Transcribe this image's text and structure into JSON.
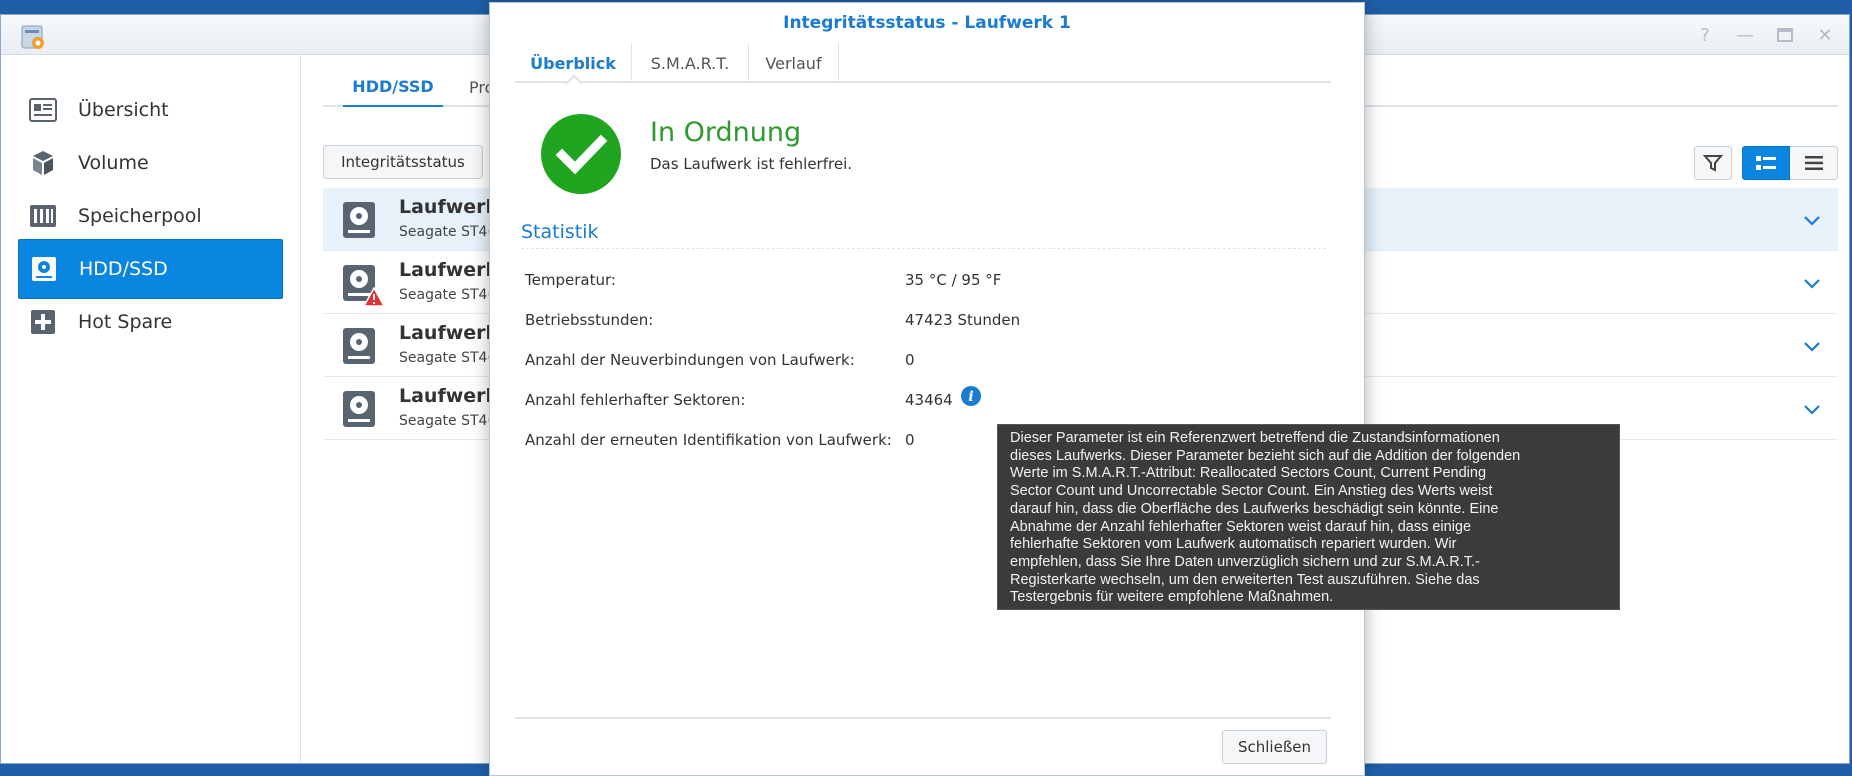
{
  "sidebar": {
    "items": [
      {
        "label": "Übersicht",
        "icon": "overview-icon"
      },
      {
        "label": "Volume",
        "icon": "volume-icon"
      },
      {
        "label": "Speicherpool",
        "icon": "storage-pool-icon"
      },
      {
        "label": "HDD/SSD",
        "icon": "hdd-icon",
        "active": true
      },
      {
        "label": "Hot Spare",
        "icon": "hot-spare-icon"
      }
    ]
  },
  "main": {
    "tabs": [
      {
        "label": "HDD/SSD",
        "active": true
      },
      {
        "label": "Pro"
      }
    ],
    "integrity_button": "Integritätsstatus",
    "drives": [
      {
        "name": "Laufwerk",
        "model": "Seagate ST4(",
        "warning": false,
        "selected": true
      },
      {
        "name": "Laufwerk",
        "model": "Seagate ST4(",
        "warning": true
      },
      {
        "name": "Laufwerk",
        "model": "Seagate ST4(",
        "warning": false
      },
      {
        "name": "Laufwerk",
        "model": "Seagate ST4(",
        "warning": false
      }
    ]
  },
  "dialog": {
    "title": "Integritätsstatus - Laufwerk 1",
    "tabs": [
      "Überblick",
      "S.M.A.R.T.",
      "Verlauf"
    ],
    "status_title": "In Ordnung",
    "status_subtitle": "Das Laufwerk ist fehlerfrei.",
    "section_title": "Statistik",
    "stats": [
      {
        "label": "Temperatur:",
        "value": "35 °C / 95 °F"
      },
      {
        "label": "Betriebsstunden:",
        "value": "47423 Stunden"
      },
      {
        "label": "Anzahl der Neuverbindungen von Laufwerk:",
        "value": "0"
      },
      {
        "label": "Anzahl fehlerhafter Sektoren:",
        "value": "43464"
      },
      {
        "label": "Anzahl der erneuten Identifikation von Laufwerk:",
        "value": "0"
      }
    ],
    "close_button": "Schließen"
  },
  "tooltip": {
    "lines": [
      "Dieser Parameter ist ein Referenzwert betreffend die Zustandsinformationen",
      "dieses Laufwerks. Dieser Parameter bezieht sich auf die Addition der folgenden",
      "Werte im S.M.A.R.T.-Attribut: Reallocated Sectors Count, Current Pending",
      "Sector Count und Uncorrectable Sector Count. Ein Anstieg des Werts weist",
      "darauf hin, dass die Oberfläche des Laufwerks beschädigt sein könnte. Eine",
      "Abnahme der Anzahl fehlerhafter Sektoren weist darauf hin, dass einige",
      "fehlerhafte Sektoren vom Laufwerk automatisch repariert wurden. Wir",
      "empfehlen, dass Sie Ihre Daten unverzüglich sichern und zur S.M.A.R.T.-",
      "Registerkarte wechseln, um den erweiterten Test auszuführen. Siehe das",
      "Testergebnis für weitere empfohlene Maßnahmen."
    ]
  },
  "colors": {
    "accent": "#1a7bd1",
    "active_sidebar": "#0a86e0",
    "ok_green": "#2f9a2f",
    "warning_red": "#e03030"
  }
}
